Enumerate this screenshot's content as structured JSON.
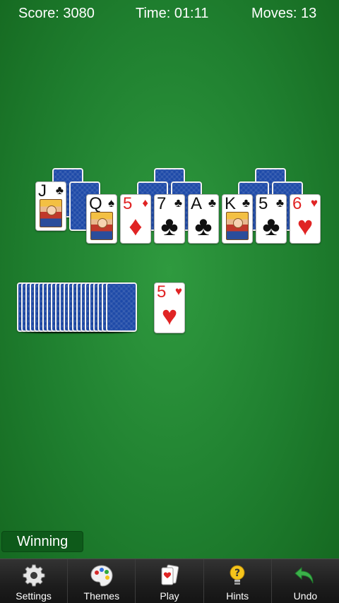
{
  "hud": {
    "score": "Score: 3080",
    "time": "Time: 01:11",
    "moves": "Moves: 13"
  },
  "peaks": {
    "row1": [
      {
        "rank": "J",
        "suit": "♣",
        "color": "black",
        "face_up": true,
        "court": true
      }
    ],
    "row2": [
      {
        "rank": "Q",
        "suit": "♠",
        "color": "black",
        "court": true
      },
      {
        "rank": "5",
        "suit": "♦",
        "color": "red"
      },
      {
        "rank": "7",
        "suit": "♣",
        "color": "black"
      },
      {
        "rank": "A",
        "suit": "♣",
        "color": "black"
      },
      {
        "rank": "K",
        "suit": "♣",
        "color": "black",
        "court": true
      },
      {
        "rank": "5",
        "suit": "♣",
        "color": "black"
      },
      {
        "rank": "6",
        "suit": "♥",
        "color": "red"
      }
    ]
  },
  "waste": {
    "rank": "5",
    "suit": "♥",
    "color": "red"
  },
  "status": {
    "label": "Winning"
  },
  "toolbar": {
    "items": [
      {
        "label": "Settings",
        "icon": "gear-icon"
      },
      {
        "label": "Themes",
        "icon": "palette-icon"
      },
      {
        "label": "Play",
        "icon": "cards-icon"
      },
      {
        "label": "Hints",
        "icon": "hint-bulb-icon"
      },
      {
        "label": "Undo",
        "icon": "undo-arrow-icon"
      }
    ]
  },
  "colors": {
    "felt": "#2a8c38",
    "card_back": "#1e4aa8",
    "red_suit": "#e02424",
    "toolbar": "#1d1d1d",
    "status_bg": "#0e5a1a"
  }
}
